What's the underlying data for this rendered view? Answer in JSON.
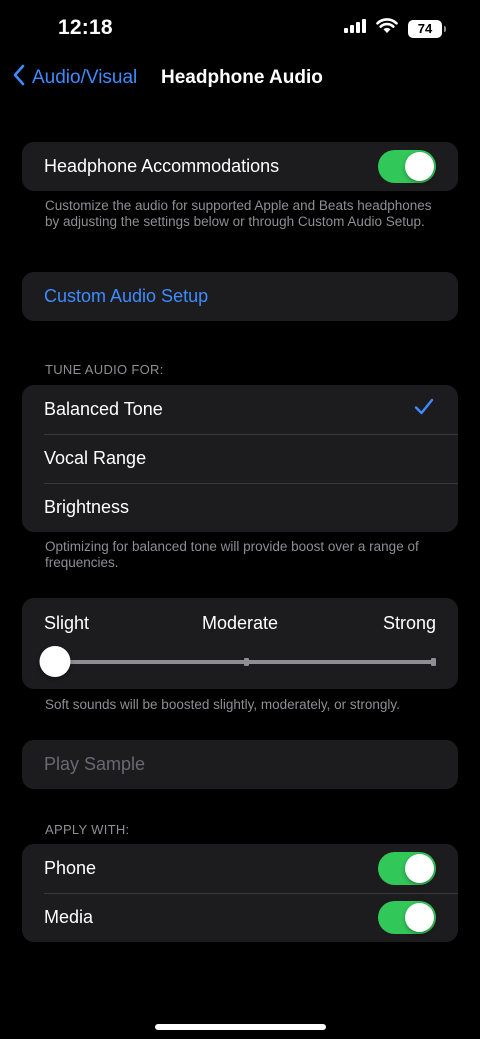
{
  "status_bar": {
    "time": "12:18",
    "battery": "74"
  },
  "nav": {
    "back_label": "Audio/Visual",
    "title": "Headphone Audio"
  },
  "accommodations": {
    "label": "Headphone Accommodations",
    "enabled": true,
    "footer": "Customize the audio for supported Apple and Beats headphones by adjusting the settings below or through Custom Audio Setup."
  },
  "custom_audio_setup": {
    "label": "Custom Audio Setup"
  },
  "tune": {
    "header": "TUNE AUDIO FOR:",
    "options": [
      {
        "label": "Balanced Tone",
        "selected": true
      },
      {
        "label": "Vocal Range",
        "selected": false
      },
      {
        "label": "Brightness",
        "selected": false
      }
    ],
    "footer": "Optimizing for balanced tone will provide boost over a range of frequencies."
  },
  "boost": {
    "labels": [
      "Slight",
      "Moderate",
      "Strong"
    ],
    "level": 0,
    "footer": "Soft sounds will be boosted slightly, moderately, or strongly."
  },
  "play_sample": {
    "label": "Play Sample"
  },
  "apply": {
    "header": "APPLY WITH:",
    "items": [
      {
        "label": "Phone",
        "enabled": true
      },
      {
        "label": "Media",
        "enabled": true
      }
    ]
  },
  "colors": {
    "accent": "#3d8bff",
    "toggle_on": "#32c759",
    "cell_bg": "#1c1c1e",
    "background": "#000000"
  }
}
